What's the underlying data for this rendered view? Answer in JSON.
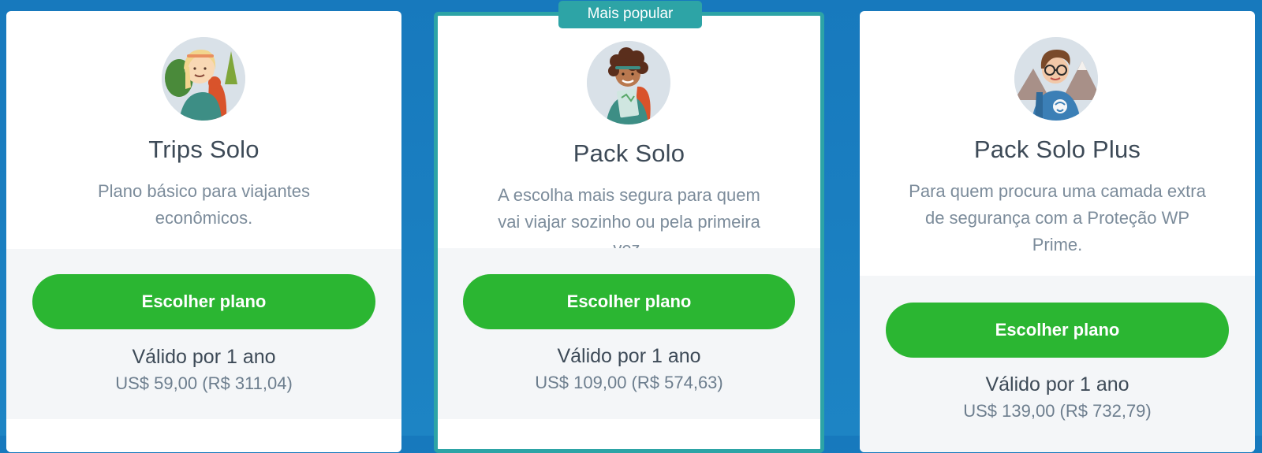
{
  "badge": {
    "label": "Mais popular"
  },
  "plans": [
    {
      "name": "Trips Solo",
      "description": "Plano básico para viajantes econômicos.",
      "button_label": "Escolher plano",
      "validity": "Válido por 1 ano",
      "price": "US$ 59,00 (R$ 311,04)",
      "avatar_icon": "traveler-woman-blonde-icon"
    },
    {
      "name": "Pack Solo",
      "description": "A escolha mais segura para quem vai viajar sozinho ou pela primeira vez.",
      "button_label": "Escolher plano",
      "validity": "Válido por 1 ano",
      "price": "US$ 109,00 (R$ 574,63)",
      "avatar_icon": "traveler-woman-curly-hair-icon"
    },
    {
      "name": "Pack Solo Plus",
      "description": "Para quem procura uma camada extra de segurança com a Proteção WP Prime.",
      "button_label": "Escolher plano",
      "validity": "Válido por 1 ano",
      "price": "US$ 139,00 (R$ 732,79)",
      "avatar_icon": "traveler-man-glasses-icon"
    }
  ],
  "colors": {
    "background": "#1a7fc1",
    "accent_teal": "#2da4a6",
    "button_green": "#2bb632",
    "card_bottom": "#f4f6f8"
  }
}
